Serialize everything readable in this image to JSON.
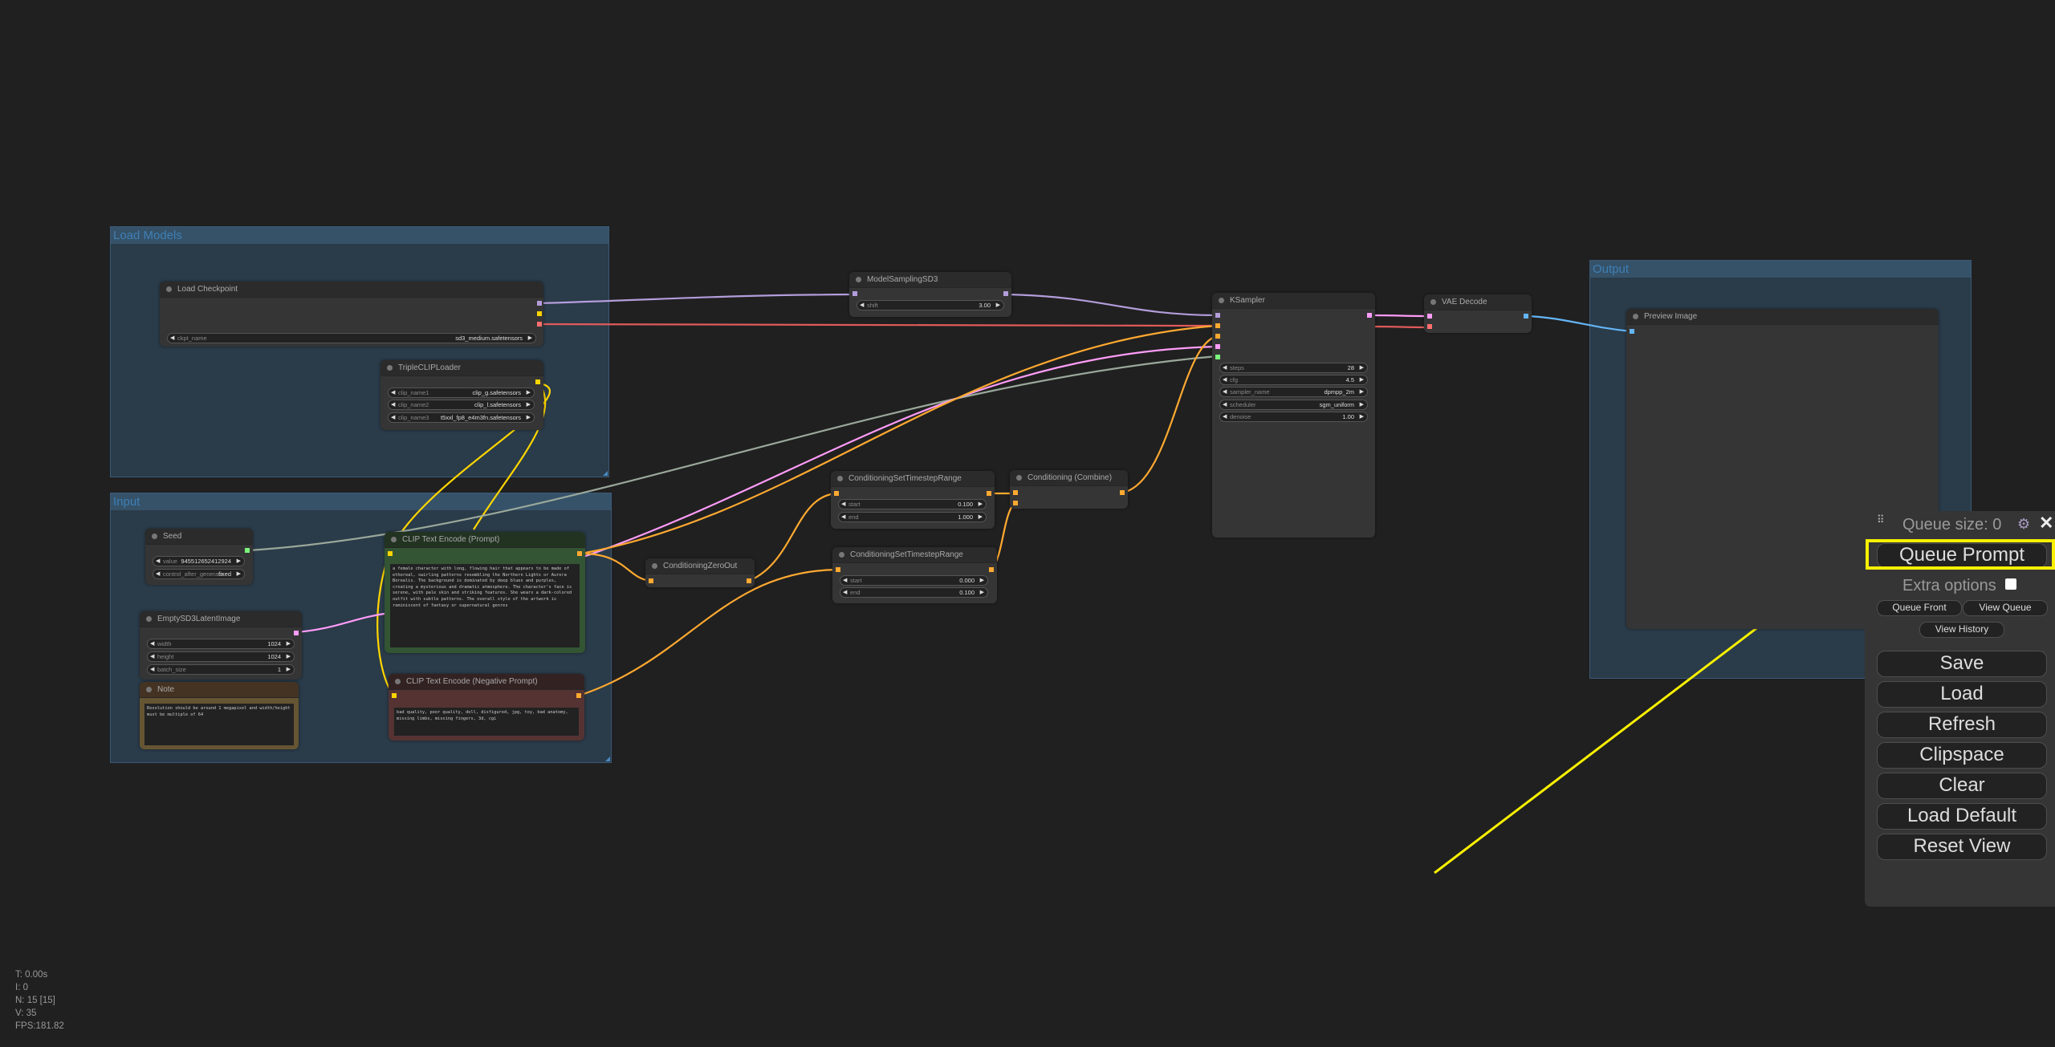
{
  "groups": {
    "load_models": "Load Models",
    "input": "Input",
    "output": "Output"
  },
  "nodes": {
    "load_checkpoint": {
      "title": "Load Checkpoint",
      "widgets": [
        {
          "name": "ckpt_name",
          "value": "sd3_medium.safetensors"
        }
      ]
    },
    "triple_clip": {
      "title": "TripleCLIPLoader",
      "widgets": [
        {
          "name": "clip_name1",
          "value": "clip_g.safetensors"
        },
        {
          "name": "clip_name2",
          "value": "clip_l.safetensors"
        },
        {
          "name": "clip_name3",
          "value": "t5xxl_fp8_e4m3fn.safetensors"
        }
      ]
    },
    "seed": {
      "title": "Seed",
      "widgets": [
        {
          "name": "value",
          "value": "945512652412924"
        },
        {
          "name": "control_after_generate",
          "value": "fixed"
        }
      ]
    },
    "empty_latent": {
      "title": "EmptySD3LatentImage",
      "widgets": [
        {
          "name": "width",
          "value": "1024"
        },
        {
          "name": "height",
          "value": "1024"
        },
        {
          "name": "batch_size",
          "value": "1"
        }
      ]
    },
    "note": {
      "title": "Note",
      "text": "Resolution should be around 1 megapixel and width/height must be multiple of 64"
    },
    "clip_pos": {
      "title": "CLIP Text Encode (Prompt)",
      "text": "a female character with long, flowing hair that appears to be made of ethereal, swirling patterns resembling the Northern Lights or Aurora Borealis. The background is dominated by deep blues and purples, creating a mysterious and dramatic atmosphere. The character's face is serene, with pale skin and striking features. She wears a dark-colored outfit with subtle patterns. The overall style of the artwork is reminiscent of fantasy or supernatural genres"
    },
    "clip_neg": {
      "title": "CLIP Text Encode (Negative Prompt)",
      "text": "bad quality, poor quality, doll, disfigured, jpg, toy, bad anatomy, missing limbs, missing fingers, 3d, cgi"
    },
    "model_sampling": {
      "title": "ModelSamplingSD3",
      "widgets": [
        {
          "name": "shift",
          "value": "3.00"
        }
      ]
    },
    "zero_out": {
      "title": "ConditioningZeroOut"
    },
    "timestep1": {
      "title": "ConditioningSetTimestepRange",
      "widgets": [
        {
          "name": "start",
          "value": "0.100"
        },
        {
          "name": "end",
          "value": "1.000"
        }
      ]
    },
    "timestep2": {
      "title": "ConditioningSetTimestepRange",
      "widgets": [
        {
          "name": "start",
          "value": "0.000"
        },
        {
          "name": "end",
          "value": "0.100"
        }
      ]
    },
    "combine": {
      "title": "Conditioning (Combine)"
    },
    "ksampler": {
      "title": "KSampler",
      "widgets": [
        {
          "name": "steps",
          "value": "28"
        },
        {
          "name": "cfg",
          "value": "4.5"
        },
        {
          "name": "sampler_name",
          "value": "dpmpp_2m"
        },
        {
          "name": "scheduler",
          "value": "sgm_uniform"
        },
        {
          "name": "denoise",
          "value": "1.00"
        }
      ]
    },
    "vae_decode": {
      "title": "VAE Decode"
    },
    "preview": {
      "title": "Preview Image"
    }
  },
  "slot_colors": {
    "model": "#b39ddb",
    "clip": "#ffd500",
    "vae": "#ff6e6e",
    "conditioning": "#ffa931",
    "latent": "#ff9cf9",
    "int": "#7cf57c",
    "image": "#64b5f6",
    "seed_link": "#9aa89a"
  },
  "stats": {
    "t": "T: 0.00s",
    "i": "I: 0",
    "n": "N: 15 [15]",
    "v": "V: 35",
    "fps": "FPS:181.82"
  },
  "menu": {
    "queue_size": "Queue size: 0",
    "queue_prompt": "Queue Prompt",
    "extra_options": "Extra options",
    "queue_front": "Queue Front",
    "view_queue": "View Queue",
    "view_history": "View History",
    "save": "Save",
    "load": "Load",
    "refresh": "Refresh",
    "clipspace": "Clipspace",
    "clear": "Clear",
    "load_default": "Load Default",
    "reset_view": "Reset View",
    "drag_icon": "⠿",
    "gear_icon": "⚙",
    "close_icon": "✕"
  },
  "annotation": {
    "highlight_color": "#f8f000"
  }
}
